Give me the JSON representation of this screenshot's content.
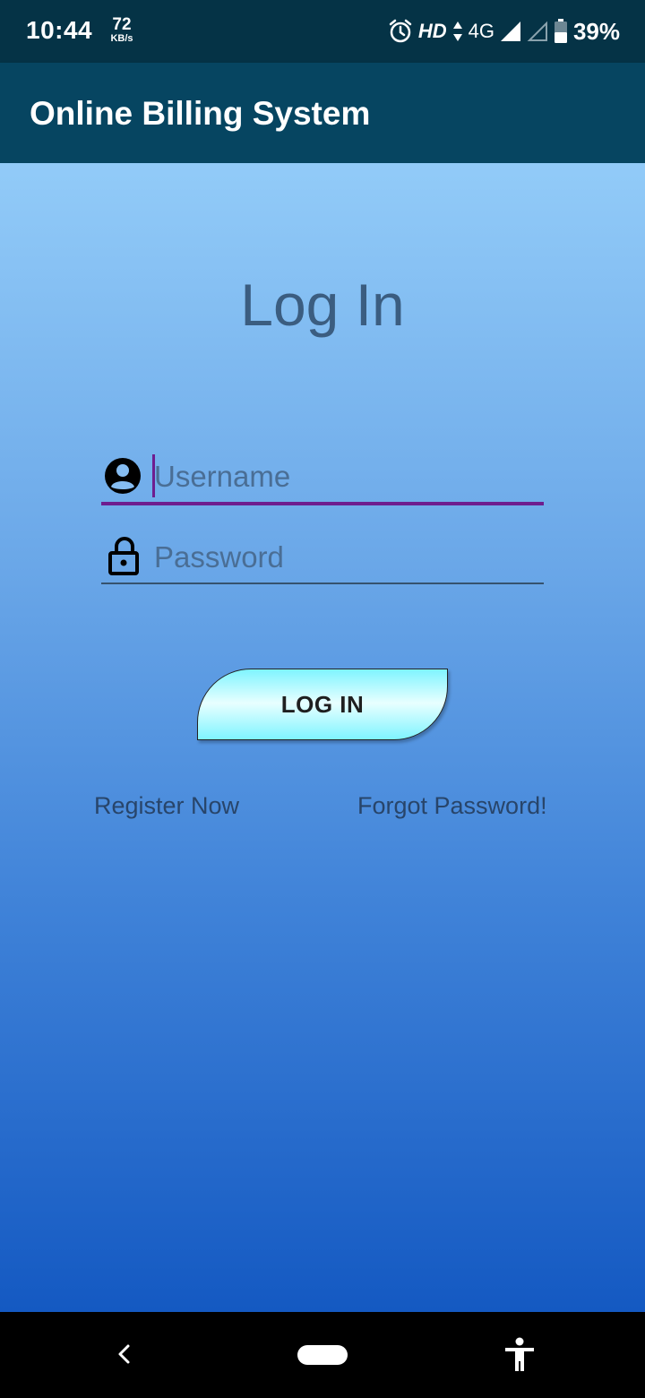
{
  "status_bar": {
    "time": "10:44",
    "net_speed_value": "72",
    "net_speed_unit": "KB/s",
    "hd": "HD",
    "network": "4G",
    "battery": "39%",
    "icons": [
      "alarm-icon",
      "data-arrows-icon",
      "signal-icon",
      "signal-empty-icon",
      "battery-icon"
    ]
  },
  "app_bar": {
    "title": "Online Billing System"
  },
  "login": {
    "title": "Log In",
    "username_placeholder": "Username",
    "password_placeholder": "Password",
    "button_label": "LOG IN",
    "register_link": "Register Now",
    "forgot_link": "Forgot Password!"
  },
  "colors": {
    "status_bar": "#053346",
    "app_bar": "#064561",
    "active_underline": "#6e1d8f",
    "button_fill": "#7ff4ff",
    "gradient_top": "#92cbf8",
    "gradient_bottom": "#1459c2"
  },
  "nav_bar": {
    "icons": [
      "back-icon",
      "home-pill-icon",
      "accessibility-icon"
    ]
  }
}
